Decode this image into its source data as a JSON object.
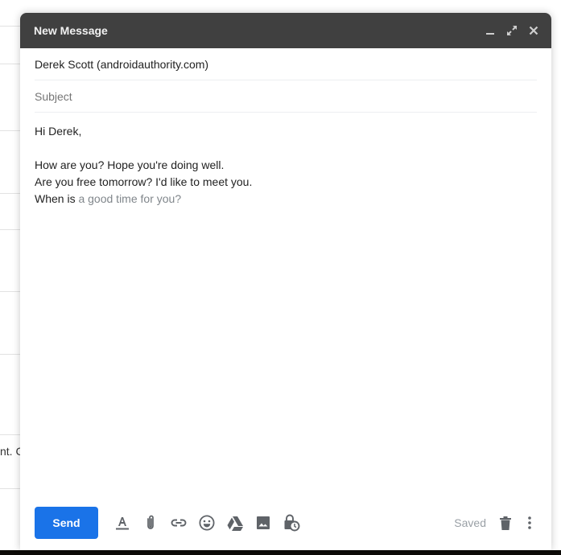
{
  "background": {
    "snippet": "nt. C"
  },
  "compose": {
    "title": "New Message",
    "header_buttons": [
      {
        "name": "minimize",
        "icon": "minimize-icon"
      },
      {
        "name": "full-screen",
        "icon": "expand-icon"
      },
      {
        "name": "close",
        "icon": "close-icon"
      }
    ],
    "to": "Derek Scott (androidauthority.com)",
    "subject_placeholder": "Subject",
    "subject_value": "",
    "body": {
      "greeting": "Hi Derek,",
      "line1": "How are you? Hope you're doing well.",
      "line2": "Are you free tomorrow? I'd like to meet you.",
      "line3_typed": "When is ",
      "line3_suggestion": "a good time for you?"
    },
    "footer": {
      "send_label": "Send",
      "tools": [
        {
          "name": "formatting-options",
          "icon": "format-text-icon"
        },
        {
          "name": "attach-files",
          "icon": "paperclip-icon"
        },
        {
          "name": "insert-link",
          "icon": "link-icon"
        },
        {
          "name": "insert-emoji",
          "icon": "emoji-icon"
        },
        {
          "name": "insert-drive-file",
          "icon": "drive-icon"
        },
        {
          "name": "insert-photo",
          "icon": "photo-icon"
        },
        {
          "name": "confidential-mode",
          "icon": "lock-clock-icon"
        }
      ],
      "status": "Saved",
      "discard_icon": "trash-icon",
      "more_icon": "more-vert-icon"
    },
    "colors": {
      "header_bg": "#404040",
      "send_button": "#1a73e8",
      "icon_gray": "#5f6368"
    }
  }
}
